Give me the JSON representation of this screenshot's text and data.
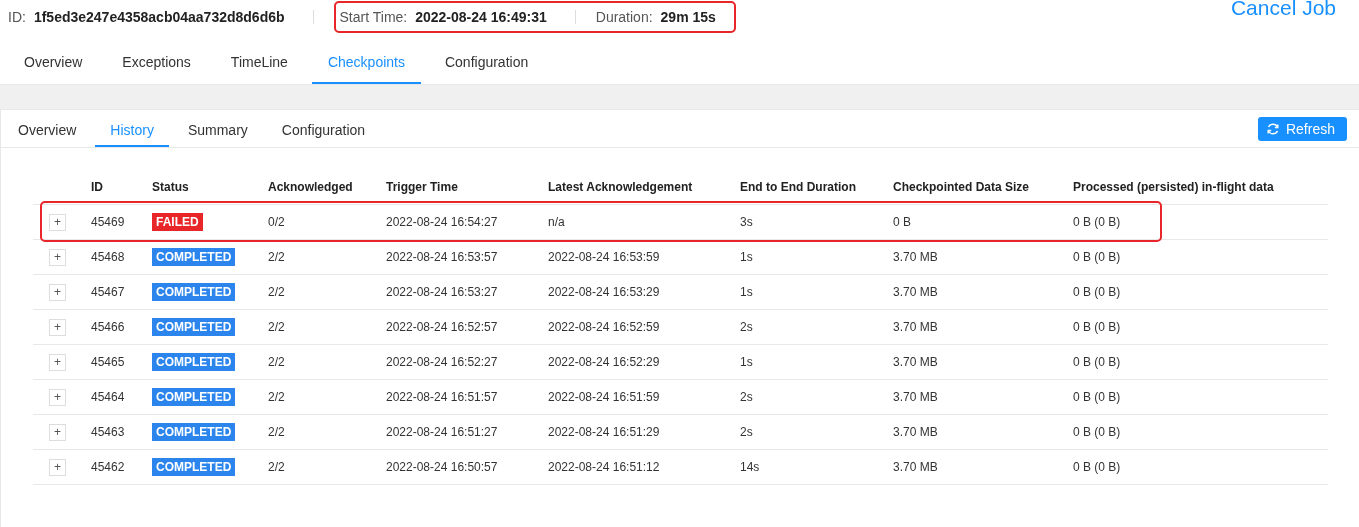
{
  "job": {
    "id_label": "ID:",
    "id": "1f5ed3e247e4358acb04aa732d8d6d6b",
    "start_label": "Start Time:",
    "start": "2022-08-24 16:49:31",
    "duration_label": "Duration:",
    "duration": "29m 15s",
    "highlighted": true,
    "cancel": "Cancel Job"
  },
  "tabs": [
    {
      "label": "Overview",
      "selected": false
    },
    {
      "label": "Exceptions",
      "selected": false
    },
    {
      "label": "TimeLine",
      "selected": false
    },
    {
      "label": "Checkpoints",
      "selected": true
    },
    {
      "label": "Configuration",
      "selected": false
    }
  ],
  "subtabs": [
    {
      "label": "Overview",
      "selected": false
    },
    {
      "label": "History",
      "selected": true
    },
    {
      "label": "Summary",
      "selected": false
    },
    {
      "label": "Configuration",
      "selected": false
    }
  ],
  "refresh": "Refresh",
  "table": {
    "columns": [
      "ID",
      "Status",
      "Acknowledged",
      "Trigger Time",
      "Latest Acknowledgement",
      "End to End Duration",
      "Checkpointed Data Size",
      "Processed (persisted) in-flight data"
    ],
    "rows": [
      {
        "expand": "+",
        "id": "45469",
        "status": "FAILED",
        "kind": "failed",
        "ack": "0/2",
        "trigger": "2022-08-24 16:54:27",
        "latest": "n/a",
        "e2e": "3s",
        "size": "0 B",
        "processed": "0 B (0 B)",
        "highlighted": true
      },
      {
        "expand": "+",
        "id": "45468",
        "status": "COMPLETED",
        "kind": "completed",
        "ack": "2/2",
        "trigger": "2022-08-24 16:53:57",
        "latest": "2022-08-24 16:53:59",
        "e2e": "1s",
        "size": "3.70 MB",
        "processed": "0 B (0 B)",
        "highlighted": false
      },
      {
        "expand": "+",
        "id": "45467",
        "status": "COMPLETED",
        "kind": "completed",
        "ack": "2/2",
        "trigger": "2022-08-24 16:53:27",
        "latest": "2022-08-24 16:53:29",
        "e2e": "1s",
        "size": "3.70 MB",
        "processed": "0 B (0 B)",
        "highlighted": false
      },
      {
        "expand": "+",
        "id": "45466",
        "status": "COMPLETED",
        "kind": "completed",
        "ack": "2/2",
        "trigger": "2022-08-24 16:52:57",
        "latest": "2022-08-24 16:52:59",
        "e2e": "2s",
        "size": "3.70 MB",
        "processed": "0 B (0 B)",
        "highlighted": false
      },
      {
        "expand": "+",
        "id": "45465",
        "status": "COMPLETED",
        "kind": "completed",
        "ack": "2/2",
        "trigger": "2022-08-24 16:52:27",
        "latest": "2022-08-24 16:52:29",
        "e2e": "1s",
        "size": "3.70 MB",
        "processed": "0 B (0 B)",
        "highlighted": false
      },
      {
        "expand": "+",
        "id": "45464",
        "status": "COMPLETED",
        "kind": "completed",
        "ack": "2/2",
        "trigger": "2022-08-24 16:51:57",
        "latest": "2022-08-24 16:51:59",
        "e2e": "2s",
        "size": "3.70 MB",
        "processed": "0 B (0 B)",
        "highlighted": false
      },
      {
        "expand": "+",
        "id": "45463",
        "status": "COMPLETED",
        "kind": "completed",
        "ack": "2/2",
        "trigger": "2022-08-24 16:51:27",
        "latest": "2022-08-24 16:51:29",
        "e2e": "2s",
        "size": "3.70 MB",
        "processed": "0 B (0 B)",
        "highlighted": false
      },
      {
        "expand": "+",
        "id": "45462",
        "status": "COMPLETED",
        "kind": "completed",
        "ack": "2/2",
        "trigger": "2022-08-24 16:50:57",
        "latest": "2022-08-24 16:51:12",
        "e2e": "14s",
        "size": "3.70 MB",
        "processed": "0 B (0 B)",
        "highlighted": false
      }
    ]
  }
}
